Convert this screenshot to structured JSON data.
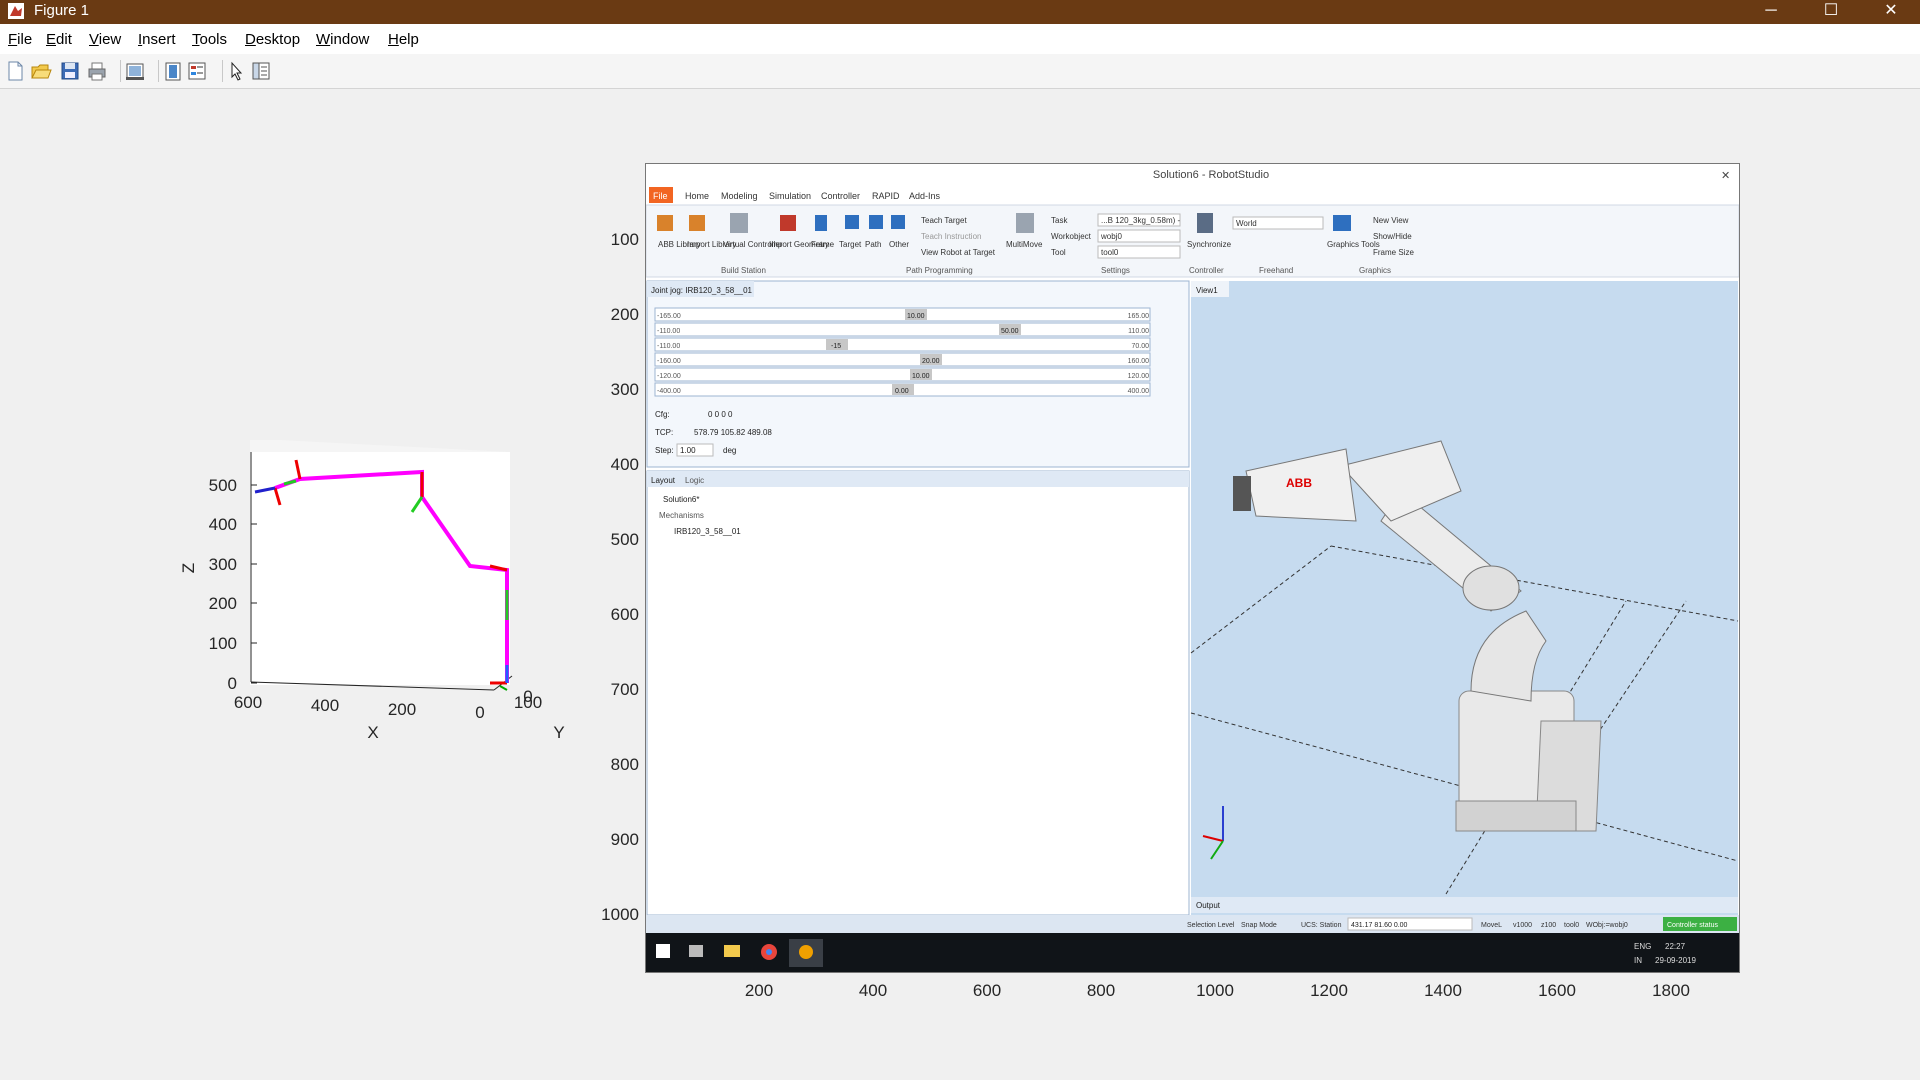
{
  "window": {
    "title": "Figure 1",
    "minimize": "─",
    "maximize": "☐",
    "close": "✕"
  },
  "menu": [
    {
      "label": "File",
      "u": "F",
      "rest": "ile"
    },
    {
      "label": "Edit",
      "u": "E",
      "rest": "dit"
    },
    {
      "label": "View",
      "u": "V",
      "rest": "iew"
    },
    {
      "label": "Insert",
      "u": "I",
      "rest": "nsert"
    },
    {
      "label": "Tools",
      "u": "T",
      "rest": "ools"
    },
    {
      "label": "Desktop",
      "u": "D",
      "rest": "esktop"
    },
    {
      "label": "Window",
      "u": "W",
      "rest": "indow"
    },
    {
      "label": "Help",
      "u": "H",
      "rest": "elp"
    }
  ],
  "toolbar": {
    "icons": [
      "new-figure-icon",
      "open-file-icon",
      "save-icon",
      "print-icon",
      "link-plot-icon",
      "insert-colorbar-icon",
      "insert-legend-icon",
      "edit-plot-icon",
      "property-inspector-icon"
    ],
    "dock_arrow": "↘"
  },
  "plot3d": {
    "xlabel": "X",
    "ylabel": "Y",
    "zlabel": "Z",
    "z_ticks": [
      "0",
      "100",
      "200",
      "300",
      "400",
      "500"
    ],
    "x_ticks": [
      "600",
      "400",
      "200",
      "0"
    ],
    "y_ticks": [
      "0",
      "100"
    ]
  },
  "image_axes": {
    "y_ticks": [
      "100",
      "200",
      "300",
      "400",
      "500",
      "600",
      "700",
      "800",
      "900",
      "1000"
    ],
    "x_ticks": [
      "200",
      "400",
      "600",
      "800",
      "1000",
      "1200",
      "1400",
      "1600",
      "1800"
    ]
  },
  "robotstudio": {
    "title": "Solution6 - RobotStudio",
    "tabs": [
      "File",
      "Home",
      "Modeling",
      "Simulation",
      "Controller",
      "RAPID",
      "Add-Ins"
    ],
    "ribbon_buttons": [
      "ABB Library",
      "Import Library",
      "Virtual Controller",
      "Import Geometry",
      "Frame",
      "Target",
      "Path",
      "Other",
      "MultiMove"
    ],
    "ribbon_path_items": [
      "Teach Target",
      "Teach Instruction",
      "View Robot at Target"
    ],
    "ribbon_settings_labels": [
      "Task",
      "Workobject",
      "Tool"
    ],
    "ribbon_settings_values": [
      "...B 120_3kg_0.58m) -",
      "wobj0",
      "tool0"
    ],
    "ribbon_world": "World",
    "ribbon_graphics_items": [
      "New View",
      "Show/Hide",
      "Frame Size"
    ],
    "ribbon_groups": [
      "Build Station",
      "Path Programming",
      "Settings",
      "Controller",
      "Freehand",
      "Graphics"
    ],
    "synchronize": "Synchronize",
    "graphics_tools": "Graphics Tools",
    "joint_jog_tab": "Joint jog: IRB120_3_58__01",
    "joints": [
      {
        "min": "-165.00",
        "val": "10.00",
        "max": "165.00"
      },
      {
        "min": "-110.00",
        "val": "50.00",
        "max": "110.00"
      },
      {
        "min": "-110.00",
        "val": "-15",
        "max": "70.00"
      },
      {
        "min": "-160.00",
        "val": "20.00",
        "max": "160.00"
      },
      {
        "min": "-120.00",
        "val": "10.00",
        "max": "120.00"
      },
      {
        "min": "-400.00",
        "val": "0.00",
        "max": "400.00"
      }
    ],
    "cfg_label": "Cfg:",
    "cfg_value": "0 0 0 0",
    "tcp_label": "TCP:",
    "tcp_value": "578.79 105.82 489.08",
    "step_label": "Step:",
    "step_value": "1.00",
    "step_unit": "deg",
    "layout_tabs": [
      "Layout",
      "Logic"
    ],
    "tree": [
      "Solution6*",
      "Mechanisms",
      "IRB120_3_58__01"
    ],
    "view_tab": "View1",
    "output_label": "Output",
    "status_left": [
      "Selection Level",
      "Snap Mode",
      "UCS: Station"
    ],
    "status_coords": "431.17 81.60 0.00",
    "status_right": [
      "MoveL",
      "v1000",
      "z100",
      "tool0",
      "WObj:=wobj0"
    ],
    "controller_status": "Controller status",
    "abb_logo": "ABB",
    "taskbar_lang_top": "ENG",
    "taskbar_lang_bottom": "IN",
    "taskbar_time": "22:27",
    "taskbar_date": "29-09-2019"
  }
}
